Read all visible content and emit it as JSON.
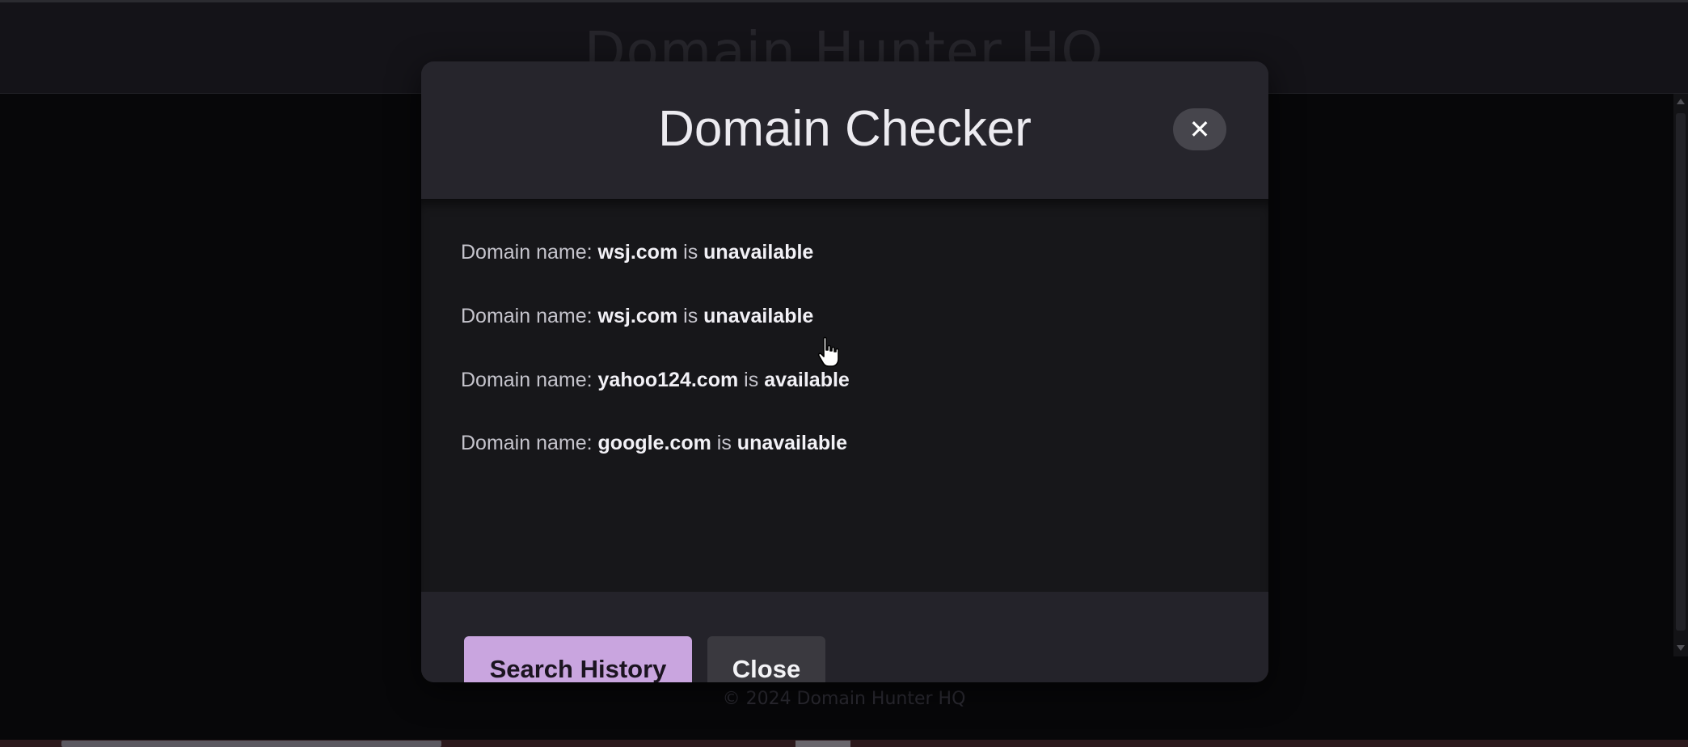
{
  "site": {
    "title": "Domain Hunter HQ",
    "footer": "© 2024 Domain Hunter HQ"
  },
  "modal": {
    "title": "Domain Checker",
    "close_icon": "close-icon",
    "close_glyph": "✕",
    "prefix": "Domain name:",
    "connector": "is",
    "results": [
      {
        "domain": "wsj.com",
        "status": "unavailable"
      },
      {
        "domain": "wsj.com",
        "status": "unavailable"
      },
      {
        "domain": "yahoo124.com",
        "status": "available"
      },
      {
        "domain": "google.com",
        "status": "unavailable"
      }
    ],
    "buttons": {
      "search_history": "Search History",
      "close": "Close"
    }
  },
  "colors": {
    "accent": "#c9a5df",
    "modal_bg": "#24232a",
    "body_bg": "#17171a"
  }
}
